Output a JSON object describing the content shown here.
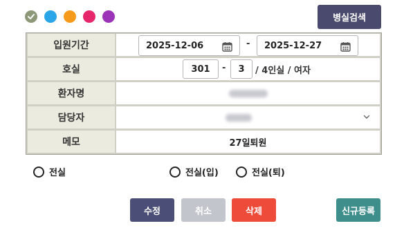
{
  "colors": {
    "dots": [
      "#8c9878",
      "#2aa6e8",
      "#f59a1b",
      "#e5266b",
      "#9c34b8"
    ],
    "search_button": "#4a4a6e",
    "edit_button": "#4b4f77",
    "cancel_button": "#c2c6cc",
    "delete_button": "#ee4b3b",
    "new_button": "#3e8e8c"
  },
  "search_button_label": "병실검색",
  "form": {
    "period": {
      "label": "입원기간",
      "start": "2025-12-06",
      "separator": "-",
      "end": "2025-12-27",
      "calendar_icon": "calendar-icon"
    },
    "room": {
      "label": "호실",
      "floor": "301",
      "separator": "-",
      "number": "3",
      "info": "/ 4인실 / 여자"
    },
    "patient": {
      "label": "환자명"
    },
    "staff": {
      "label": "담당자",
      "dropdown_icon": "chevron-down-icon"
    },
    "memo": {
      "label": "메모",
      "value": "27일퇴원"
    }
  },
  "radios": [
    {
      "label": "전실"
    },
    {
      "label": "전실(입)"
    },
    {
      "label": "전실(퇴)"
    }
  ],
  "actions": {
    "edit": "수정",
    "cancel": "취소",
    "delete": "삭제",
    "new": "신규등록"
  }
}
